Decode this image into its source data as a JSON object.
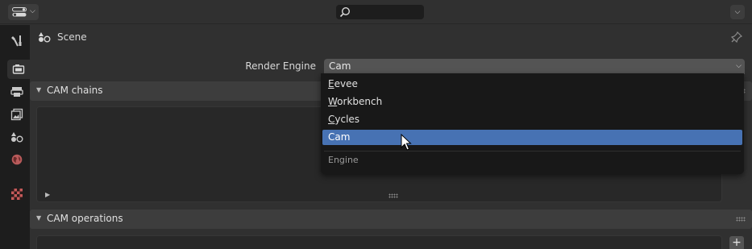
{
  "header": {
    "search_placeholder": ""
  },
  "context": {
    "label": "Scene"
  },
  "render_engine": {
    "label": "Render Engine",
    "value": "Cam"
  },
  "panels": {
    "chains_title": "CAM chains",
    "operations_title": "CAM operations"
  },
  "menu": {
    "items": [
      {
        "first": "E",
        "rest": "evee"
      },
      {
        "first": "W",
        "rest": "orkbench"
      },
      {
        "first": "C",
        "rest": "ycles"
      },
      {
        "first": "C",
        "rest": "am"
      }
    ],
    "selected_index": 3,
    "section_label": "Engine"
  },
  "colors": {
    "accent": "#4772b3",
    "background": "#303030",
    "tab_strip": "#1d1d1d"
  },
  "icons": [
    "editor-type-icon",
    "search-icon",
    "pin-icon",
    "tool-icon",
    "render-icon",
    "output-icon",
    "view-layer-icon",
    "scene-icon",
    "world-icon",
    "texture-icon",
    "mouse-cursor-icon"
  ]
}
